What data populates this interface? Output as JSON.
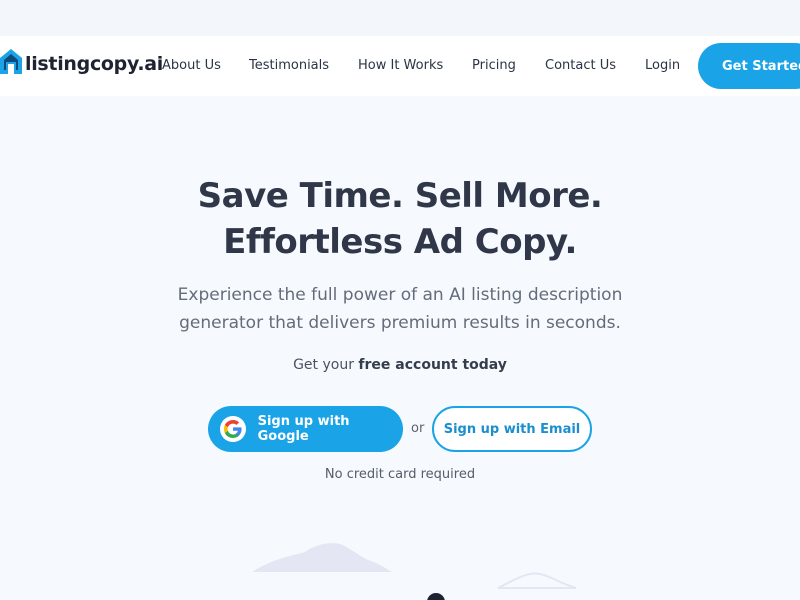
{
  "brand": {
    "name": "listingcopy.ai"
  },
  "nav": {
    "items": [
      {
        "label": "About Us"
      },
      {
        "label": "Testimonials"
      },
      {
        "label": "How It Works"
      },
      {
        "label": "Pricing"
      },
      {
        "label": "Contact Us"
      },
      {
        "label": "Login"
      }
    ],
    "cta_label": "Get Started"
  },
  "hero": {
    "title_line1": "Save Time. Sell More.",
    "title_line2": "Effortless Ad Copy.",
    "subtitle_line1": "Experience the full power of an AI listing description",
    "subtitle_line2": "generator that delivers premium results in seconds.",
    "account_prefix": "Get your",
    "account_bold": "free account today",
    "google_button": "Sign up with Google",
    "or_text": "or",
    "email_button": "Sign up with Email",
    "no_cc": "No credit card required"
  },
  "colors": {
    "accent": "#1aa3e6",
    "heading": "#2f3748",
    "background": "#f6f9fd"
  },
  "icons": {
    "logo": "house-logo-icon",
    "google": "google-g-icon"
  }
}
